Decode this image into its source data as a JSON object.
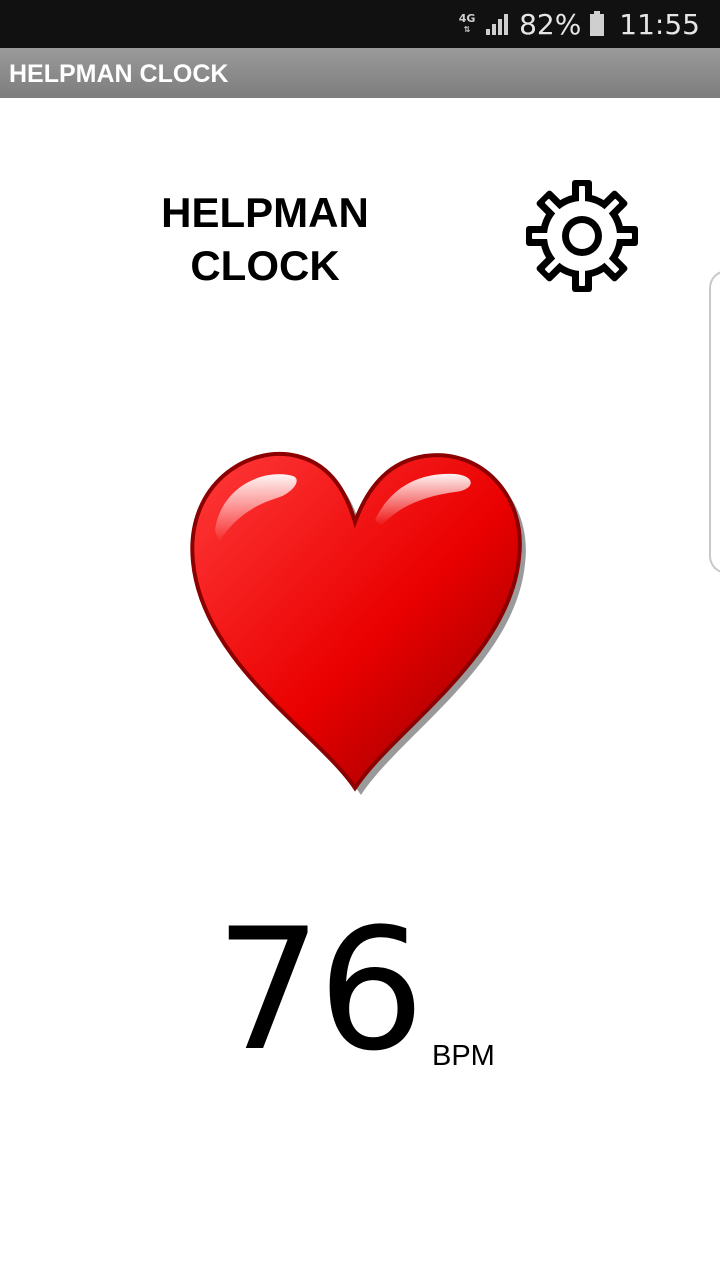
{
  "status_bar": {
    "network": "4G",
    "battery": "82%",
    "time": "11:55"
  },
  "app_bar": {
    "title": "HELPMAN CLOCK"
  },
  "header": {
    "title_line1": "HELPMAN",
    "title_line2": "CLOCK",
    "settings_icon": "gear-icon"
  },
  "heart": {
    "icon": "heart-icon",
    "color": "#e60000"
  },
  "reading": {
    "value": "76",
    "unit": "BPM"
  }
}
